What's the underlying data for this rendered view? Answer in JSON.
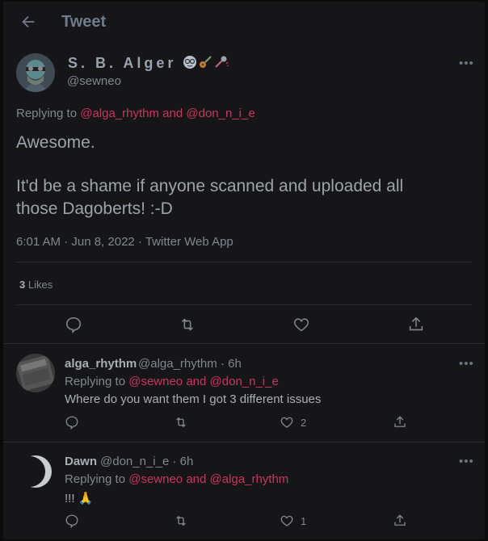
{
  "header": {
    "title": "Tweet"
  },
  "main_tweet": {
    "display_name": "S. B. Alger",
    "handle": "@sewneo",
    "replying_prefix": "Replying to",
    "replying_to_1": "@alga_rhythm",
    "replying_and": "and",
    "replying_to_2": "@don_n_i_e",
    "text_line1": "Awesome.",
    "text_line2": "It'd be a shame if anyone scanned and uploaded all",
    "text_line3": "those Dagoberts! :-D",
    "meta": "6:01 AM · Jun 8, 2022 · Twitter Web App",
    "likes_count": "3",
    "likes_label": "Likes"
  },
  "replies": [
    {
      "name": "alga_rhythm",
      "handle_time": "@alga_rhythm · 6h",
      "replying_prefix": "Replying to",
      "replying_to_1": "@sewneo",
      "replying_and": "and",
      "replying_to_2": "@don_n_i_e",
      "text": "Where do you want them I got 3 different issues",
      "like_count": "2"
    },
    {
      "name": "Dawn",
      "handle_time": "@don_n_i_e · 6h",
      "replying_prefix": "Replying to",
      "replying_to_1": "@sewneo",
      "replying_and": "and",
      "replying_to_2": "@alga_rhythm",
      "text": "!!! 🙏",
      "like_count": "1"
    }
  ],
  "icons": {
    "more": "more-icon",
    "reply": "reply-icon",
    "retweet": "retweet-icon",
    "like": "heart-icon",
    "share": "share-icon"
  },
  "colors": {
    "accent_pink": "#c8365e",
    "background": "#161618",
    "muted_text": "#7f8790",
    "divider": "#2b2d31"
  }
}
